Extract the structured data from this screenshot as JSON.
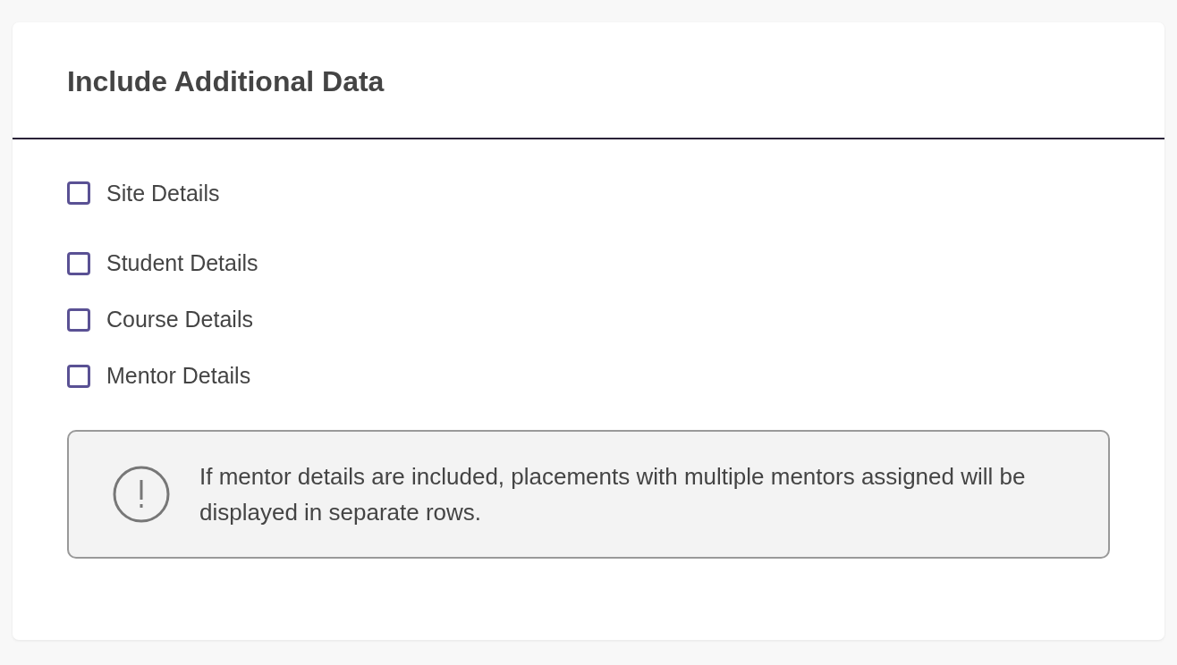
{
  "card": {
    "title": "Include Additional Data",
    "options": [
      {
        "label": "Site Details",
        "checked": false
      },
      {
        "label": "Student Details",
        "checked": false
      },
      {
        "label": "Course Details",
        "checked": false
      },
      {
        "label": "Mentor Details",
        "checked": false
      }
    ],
    "notice": {
      "text": "If mentor details are included, placements with multiple mentors assigned will be displayed in separate rows."
    }
  }
}
